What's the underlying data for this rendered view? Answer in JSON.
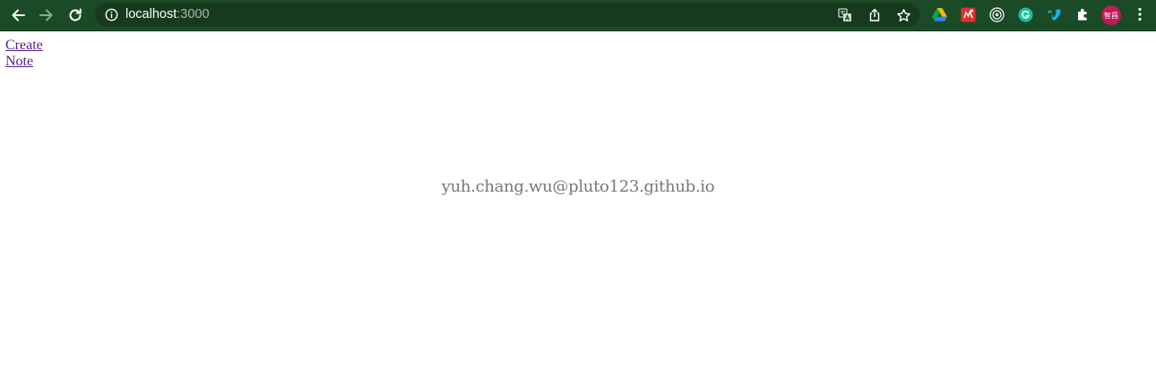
{
  "browser": {
    "url_host": "localhost",
    "url_port": ":3000",
    "avatar_text": "智昌",
    "colors": {
      "toolbar_bg": "#1b4a27",
      "omnibox_bg": "#163a20"
    },
    "icons": [
      "back-icon",
      "forward-icon",
      "reload-icon",
      "info-icon",
      "translate-icon",
      "share-icon",
      "bookmark-star-icon",
      "google-drive-icon",
      "extension-red-icon",
      "extension-target-icon",
      "grammarly-icon",
      "vimeo-icon",
      "extensions-puzzle-icon",
      "more-menu-icon"
    ]
  },
  "page": {
    "nav": {
      "create_label": "Create",
      "note_label": "Note"
    },
    "footer_email": "yuh.chang.wu@pluto123.github.io",
    "colors": {
      "link": "#551a8b",
      "footer_text": "#777777"
    }
  }
}
